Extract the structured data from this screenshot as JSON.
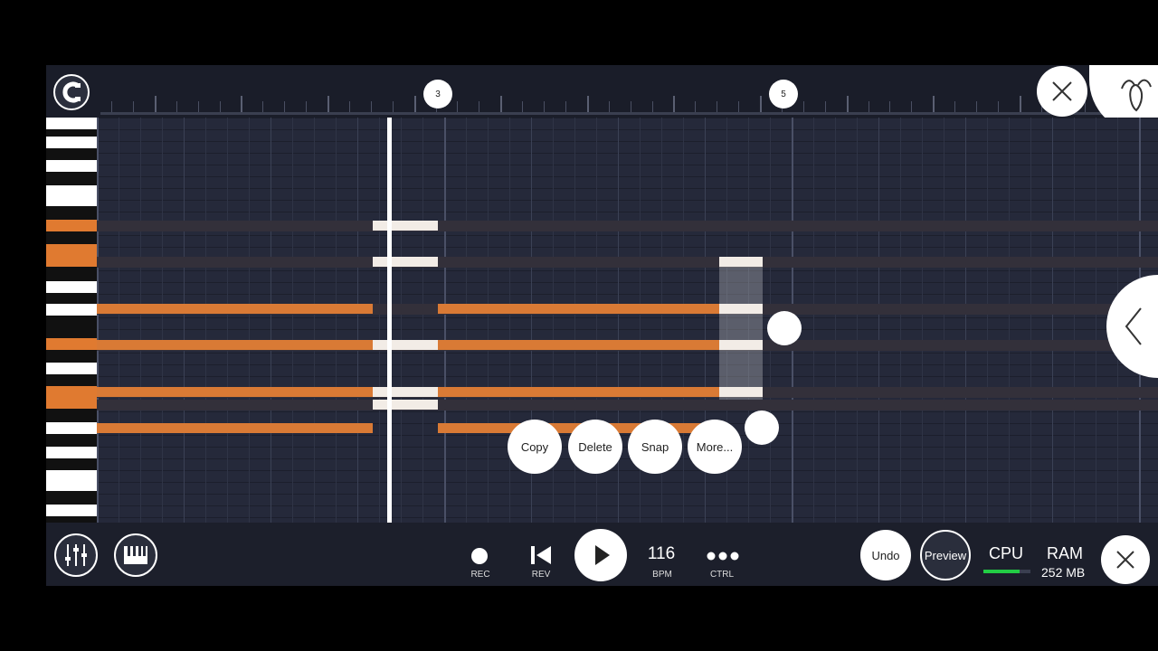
{
  "ruler": {
    "markers": [
      {
        "label": "3"
      },
      {
        "label": "5"
      }
    ]
  },
  "context_menu": {
    "copy": "Copy",
    "delete": "Delete",
    "snap": "Snap",
    "more": "More..."
  },
  "transport": {
    "rec_label": "REC",
    "rev_label": "REV",
    "tempo_value": "116",
    "tempo_label": "BPM",
    "ctrl_label": "CTRL"
  },
  "right_controls": {
    "undo_label": "Undo",
    "preview_label": "Preview",
    "cpu_label": "CPU",
    "ram_label": "RAM",
    "ram_value": "252 MB"
  },
  "colors": {
    "note": "#d97a35",
    "selected_note": "#f2ece6",
    "background": "#232737",
    "cpu_meter": "#22cc44"
  },
  "icons": [
    "magnet-snap-icon",
    "close-icon",
    "fl-fruit-logo-icon",
    "chevron-left-icon",
    "mixer-icon",
    "piano-icon",
    "record-icon",
    "rewind-icon",
    "play-icon",
    "more-dots-icon",
    "close-icon"
  ]
}
